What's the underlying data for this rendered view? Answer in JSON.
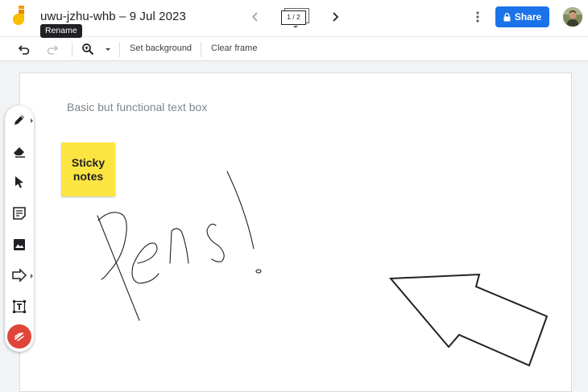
{
  "header": {
    "title": "uwu-jzhu-whb – 9 Jul 2023",
    "tooltip": "Rename",
    "frame_indicator": "1 / 2",
    "share_label": "Share"
  },
  "toolbar": {
    "set_background": "Set background",
    "clear_frame": "Clear frame"
  },
  "canvas": {
    "text_box": "Basic but functional text box",
    "sticky_note": "Sticky notes",
    "sticky_color": "#fde541"
  },
  "tools": [
    "pen-icon",
    "eraser-icon",
    "select-icon",
    "sticky-note-icon",
    "image-icon",
    "shape-arrow-icon",
    "text-box-icon",
    "laser-icon"
  ],
  "colors": {
    "accent": "#1a73e8",
    "laser": "#e0453a"
  }
}
